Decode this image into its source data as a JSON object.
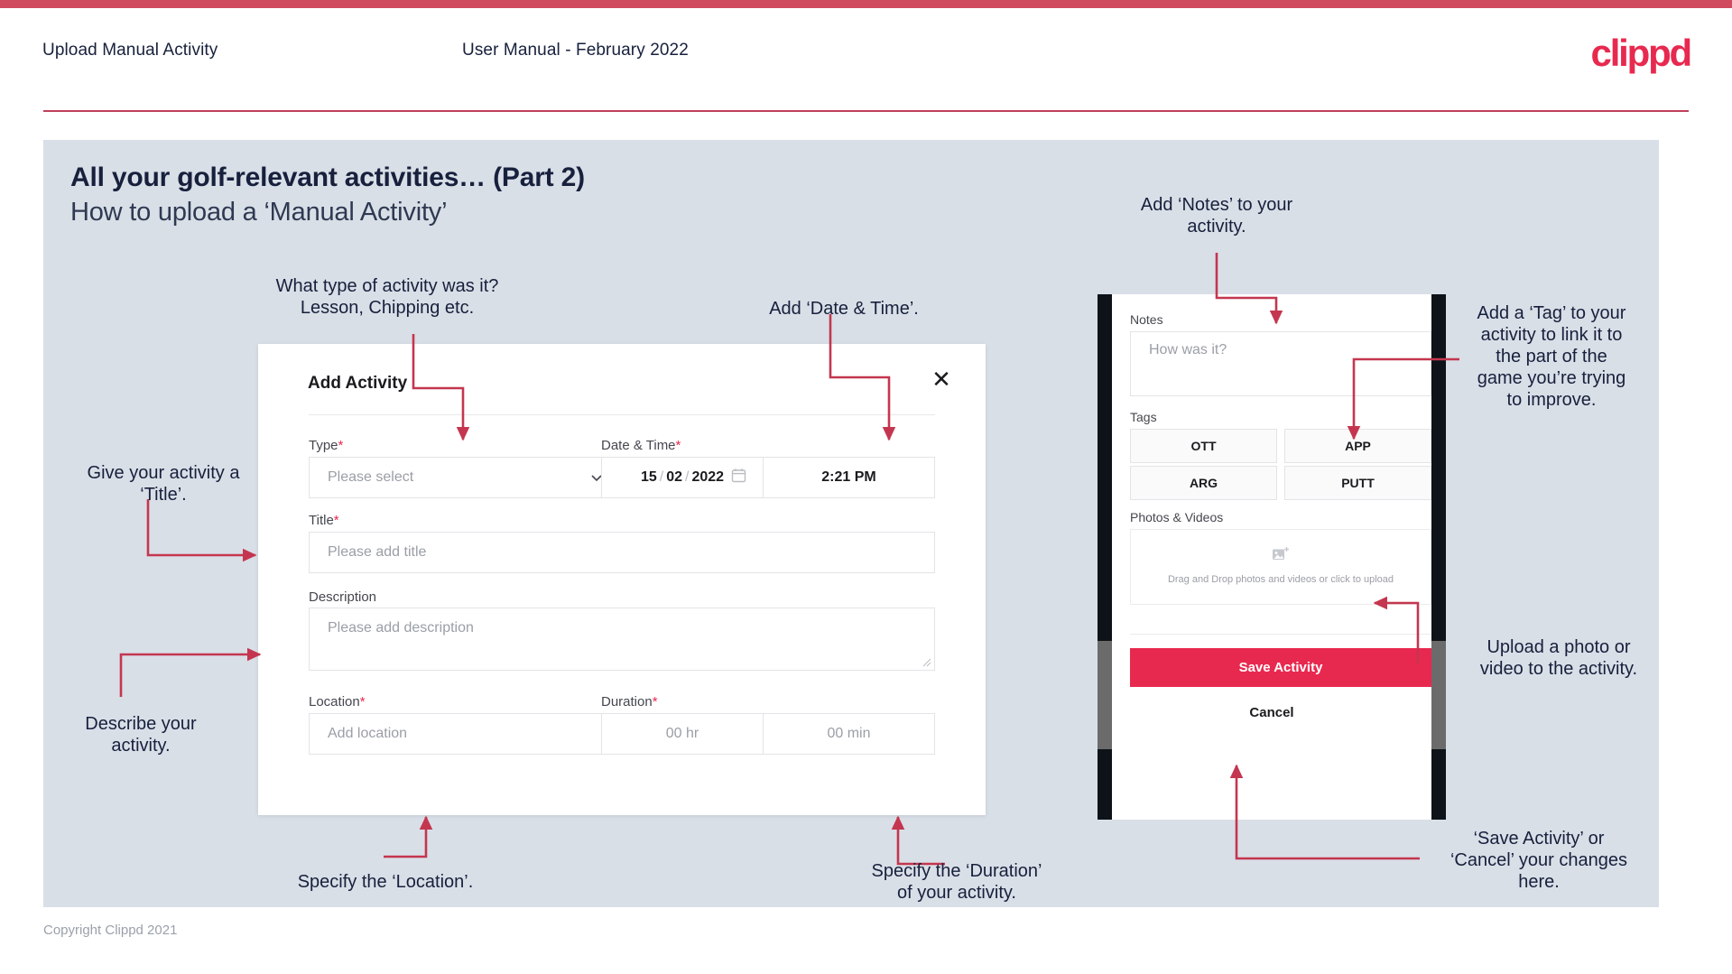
{
  "header": {
    "title": "Upload Manual Activity",
    "subtitle": "User Manual - February 2022",
    "logo": "clippd"
  },
  "slide": {
    "title": "All your golf-relevant activities… (Part 2)",
    "subtitle": "How to upload a ‘Manual Activity’"
  },
  "footer": {
    "copyright": "Copyright Clippd 2021"
  },
  "dialog": {
    "title": "Add Activity",
    "close_label": "✕",
    "fields": {
      "type": {
        "label": "Type",
        "required": "*",
        "placeholder": "Please select"
      },
      "datetime": {
        "label": "Date & Time",
        "required": "*",
        "day": "15",
        "month": "02",
        "year": "2022",
        "sep": "/",
        "time": "2:21 PM"
      },
      "title": {
        "label": "Title",
        "required": "*",
        "placeholder": "Please add title"
      },
      "description": {
        "label": "Description",
        "required": "",
        "placeholder": "Please add description"
      },
      "location": {
        "label": "Location",
        "required": "*",
        "placeholder": "Add location"
      },
      "duration": {
        "label": "Duration",
        "required": "*",
        "hours": "00 hr",
        "minutes": "00 min"
      }
    }
  },
  "phone": {
    "notes": {
      "label": "Notes",
      "placeholder": "How was it?"
    },
    "tags": {
      "label": "Tags",
      "items": [
        "OTT",
        "APP",
        "ARG",
        "PUTT"
      ]
    },
    "photos": {
      "label": "Photos & Videos",
      "drop_text": "Drag and Drop photos and videos or\nclick to upload"
    },
    "save_label": "Save Activity",
    "cancel_label": "Cancel"
  },
  "annotations": {
    "type": "What type of activity was it?\nLesson, Chipping etc.",
    "datetime": "Add ‘Date & Time’.",
    "title": "Give your activity a\n‘Title’.",
    "description": "Describe your\nactivity.",
    "location": "Specify the ‘Location’.",
    "duration": "Specify the ‘Duration’\nof your activity.",
    "notes": "Add ‘Notes’ to your\nactivity.",
    "tags": "Add a ‘Tag’ to your\nactivity to link it to\nthe part of the\ngame you’re trying\nto improve.",
    "photos": "Upload a photo or\nvideo to the activity.",
    "save": "‘Save Activity’ or\n‘Cancel’ your changes\nhere."
  },
  "colors": {
    "brand": "#e8294f",
    "topbar": "#cf4a5e",
    "slide_bg": "#d9dfe7",
    "ink": "#17203c",
    "arrow": "#c4364f"
  }
}
